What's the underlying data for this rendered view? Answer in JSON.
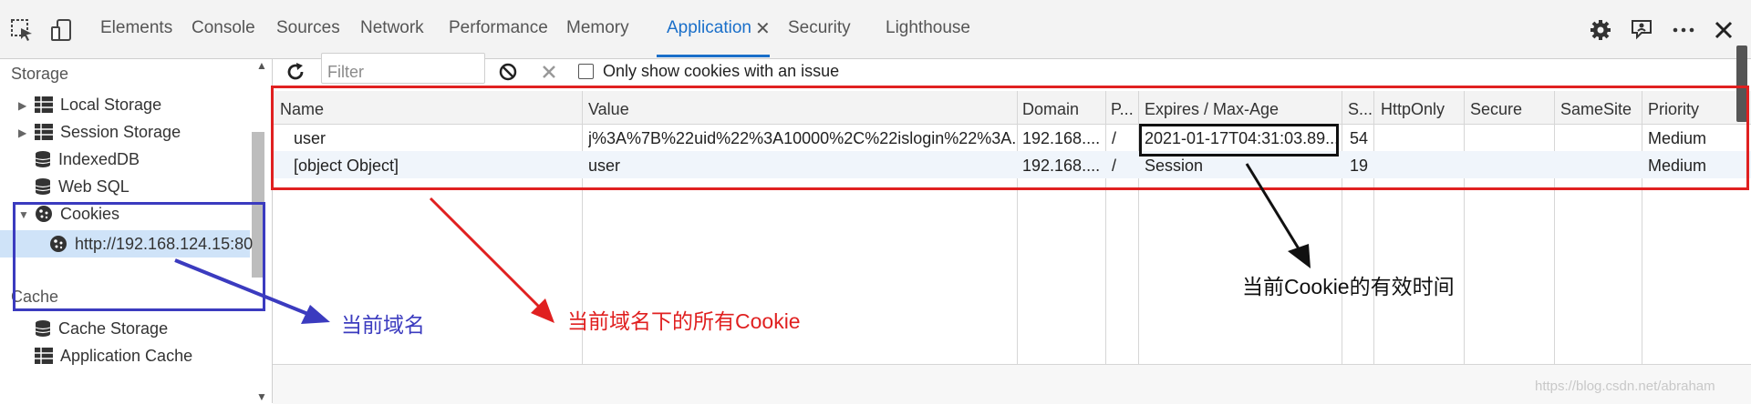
{
  "tabs": [
    {
      "label": "Elements"
    },
    {
      "label": "Console"
    },
    {
      "label": "Sources"
    },
    {
      "label": "Network"
    },
    {
      "label": "Performance"
    },
    {
      "label": "Memory"
    },
    {
      "label": "Application",
      "active": true
    },
    {
      "label": "Security"
    },
    {
      "label": "Lighthouse"
    }
  ],
  "toolbar_icons": [
    "inspect-icon",
    "device-toggle-icon",
    "settings-icon",
    "feedback-icon",
    "more-icon",
    "close-icon"
  ],
  "sidebar": {
    "storage_heading": "Storage",
    "items": [
      {
        "label": "Local Storage",
        "icon": "table-icon",
        "expandable": true
      },
      {
        "label": "Session Storage",
        "icon": "table-icon",
        "expandable": true
      },
      {
        "label": "IndexedDB",
        "icon": "database-icon"
      },
      {
        "label": "Web SQL",
        "icon": "database-icon"
      },
      {
        "label": "Cookies",
        "icon": "cookie-icon",
        "expanded": true
      },
      {
        "label": "http://192.168.124.15:80",
        "icon": "cookie-icon",
        "selected": true
      }
    ],
    "cache_heading": "Cache",
    "cache_items": [
      {
        "label": "Cache Storage",
        "icon": "database-icon"
      },
      {
        "label": "Application Cache",
        "icon": "table-icon"
      }
    ]
  },
  "cookies_toolbar": {
    "filter_placeholder": "Filter",
    "only_issue_label": "Only show cookies with an issue",
    "only_issue_checked": false
  },
  "table": {
    "columns": [
      "Name",
      "Value",
      "Domain",
      "P...",
      "Expires / Max-Age",
      "S...",
      "HttpOnly",
      "Secure",
      "SameSite",
      "Priority"
    ],
    "rows": [
      [
        "user",
        "j%3A%7B%22uid%22%3A10000%2C%22islogin%22%3A...",
        "192.168....",
        "/",
        "2021-01-17T04:31:03.89...",
        "54",
        "",
        "",
        "",
        "Medium"
      ],
      [
        "[object Object]",
        "user",
        "192.168....",
        "/",
        "Session",
        "19",
        "",
        "",
        "",
        "Medium"
      ]
    ]
  },
  "annotations": {
    "domain_label": "当前域名",
    "all_cookies_label": "当前域名下的所有Cookie",
    "expiry_label": "当前Cookie的有效时间",
    "colors": {
      "red": "#e02020",
      "blue": "#3b3bbf",
      "black": "#111111"
    }
  },
  "watermark": "https://blog.csdn.net/abraham"
}
